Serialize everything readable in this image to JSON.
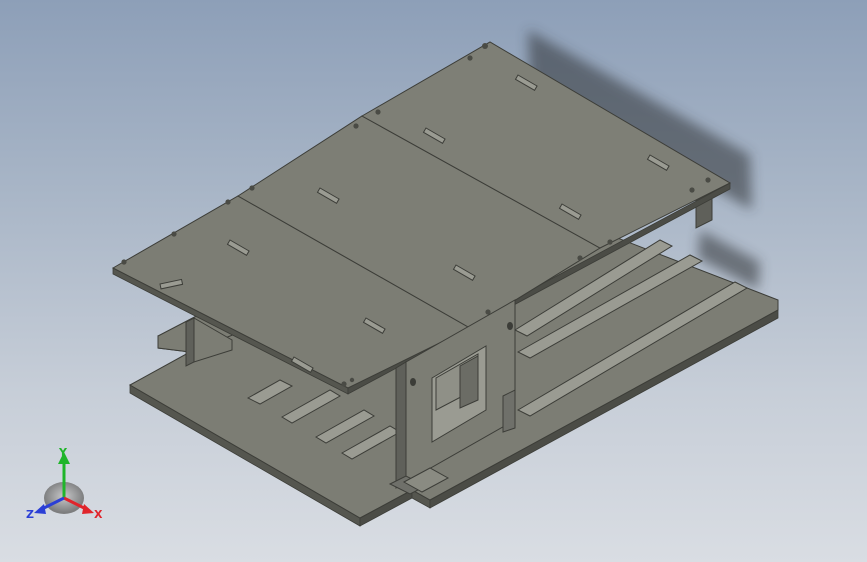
{
  "viewport": {
    "background_top": "#8d9fb8",
    "background_bottom": "#d9dde3"
  },
  "model": {
    "plate_color": "#7c7d74",
    "edge_color": "#3c3d38",
    "side_color": "#5f605a",
    "highlight_color": "#9a9b92"
  },
  "triad": {
    "x_label": "X",
    "y_label": "Y",
    "z_label": "Z",
    "x_color": "#e0242b",
    "y_color": "#1fb52a",
    "z_color": "#2b3fd6"
  }
}
